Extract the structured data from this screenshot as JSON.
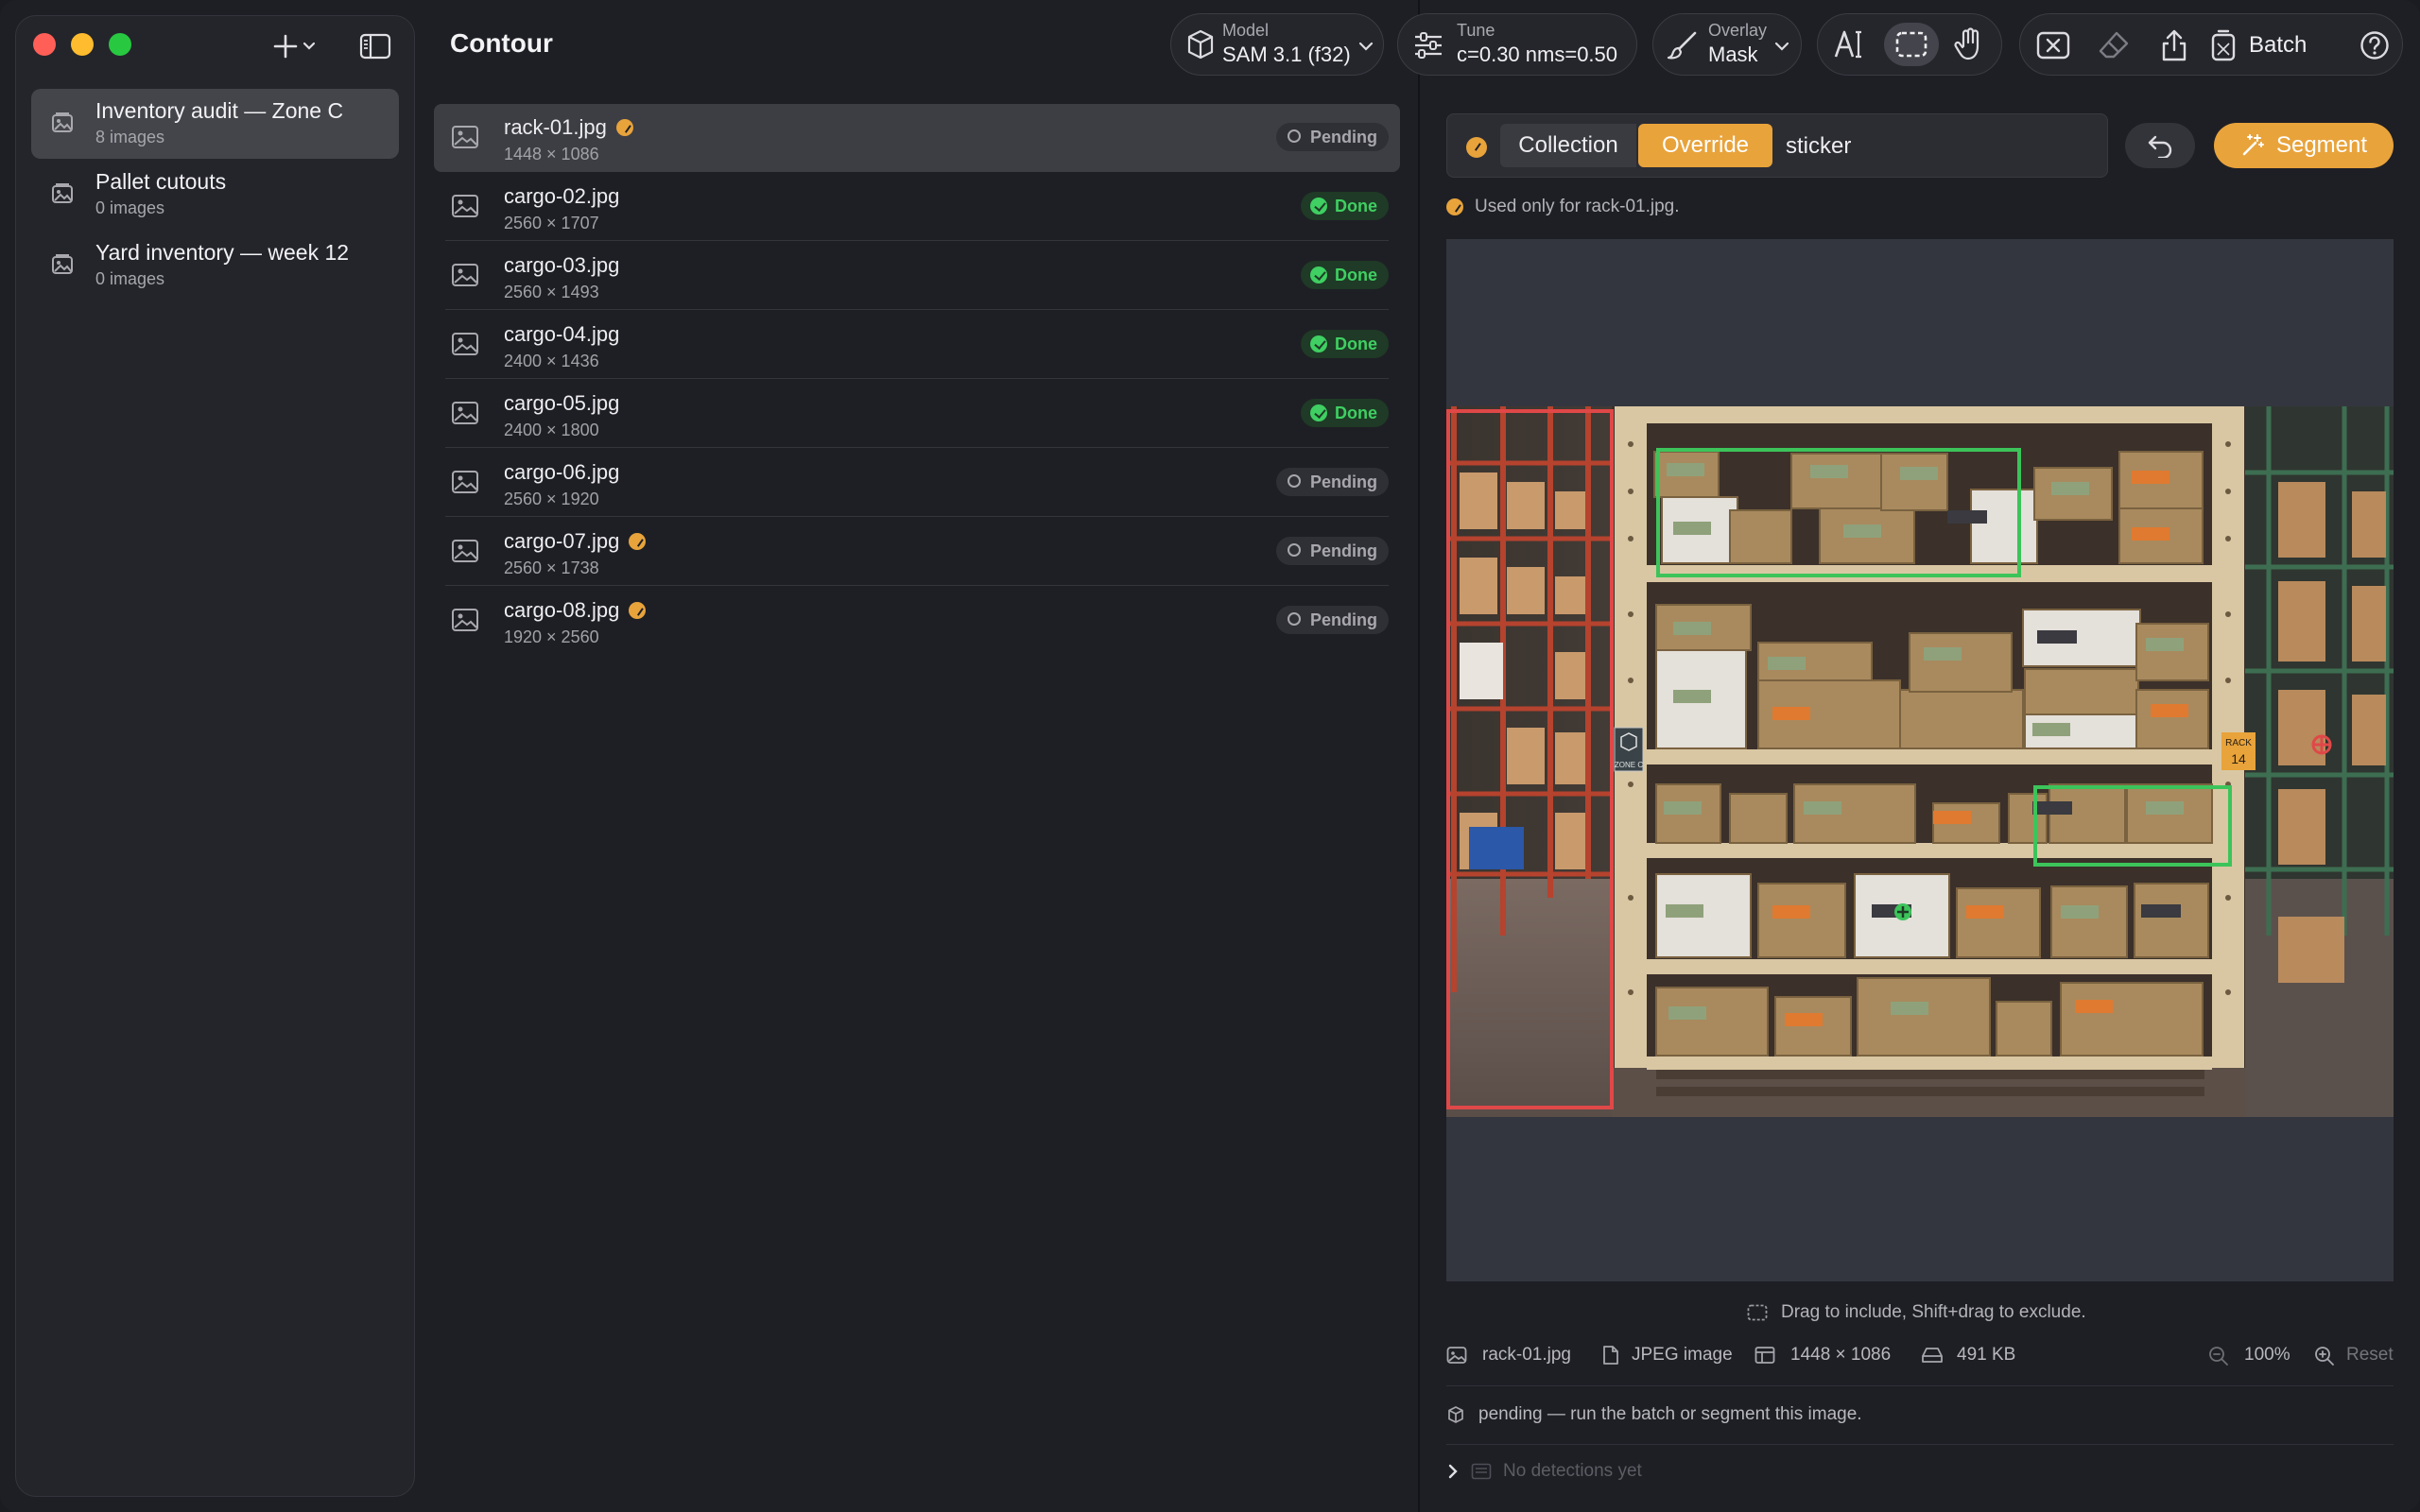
{
  "sidebar": {
    "collections": [
      {
        "name": "Inventory audit — Zone C",
        "count": "8 images"
      },
      {
        "name": "Pallet cutouts",
        "count": "0 images"
      },
      {
        "name": "Yard inventory — week 12",
        "count": "0 images"
      }
    ]
  },
  "list": {
    "title": "Contour",
    "rows": [
      {
        "file": "rack-01.jpg",
        "dims": "1448 × 1086",
        "status": "Pending",
        "override": true
      },
      {
        "file": "cargo-02.jpg",
        "dims": "2560 × 1707",
        "status": "Done",
        "override": false
      },
      {
        "file": "cargo-03.jpg",
        "dims": "2560 × 1493",
        "status": "Done",
        "override": false
      },
      {
        "file": "cargo-04.jpg",
        "dims": "2400 × 1436",
        "status": "Done",
        "override": false
      },
      {
        "file": "cargo-05.jpg",
        "dims": "2400 × 1800",
        "status": "Done",
        "override": false
      },
      {
        "file": "cargo-06.jpg",
        "dims": "2560 × 1920",
        "status": "Pending",
        "override": false
      },
      {
        "file": "cargo-07.jpg",
        "dims": "2560 × 1738",
        "status": "Pending",
        "override": true
      },
      {
        "file": "cargo-08.jpg",
        "dims": "1920 × 2560",
        "status": "Pending",
        "override": true
      }
    ]
  },
  "toolbar": {
    "model_label": "Model",
    "model_value": "SAM 3.1 (f32)",
    "tune_label": "Tune",
    "tune_value": "c=0.30 nms=0.50",
    "overlay_label": "Overlay",
    "overlay_value": "Mask",
    "batch_label": "Batch"
  },
  "prompt": {
    "mode_collection": "Collection",
    "mode_override": "Override",
    "text": "sticker",
    "segment_label": "Segment",
    "note": "Used only for rack-01.jpg."
  },
  "canvas": {
    "zone_label": "ZONE C",
    "rack_label_1": "RACK",
    "rack_label_2": "14",
    "hint": "Drag to include, Shift+drag to exclude."
  },
  "info": {
    "file": "rack-01.jpg",
    "type": "JPEG image",
    "dims": "1448 × 1086",
    "size": "491 KB",
    "zoom": "100%",
    "reset": "Reset",
    "status": "pending — run the batch or segment this image.",
    "detections": "No detections yet"
  },
  "colors": {
    "accent": "#e8a33b",
    "done": "#3fcf62",
    "exclude_box": "#e04848",
    "include_box": "#3cc45a"
  }
}
